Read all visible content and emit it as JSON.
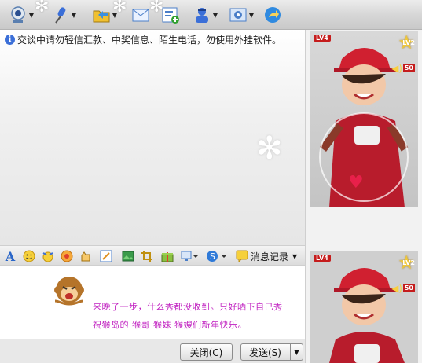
{
  "notice": {
    "text": "交谈中请勿轻信汇款、中奖信息、陌生电话，勿使用外挂软件。"
  },
  "format_bar": {
    "font_label": "A",
    "message_record_label": "消息记录"
  },
  "chat_input": {
    "line1": "来晚了一步，什么秀都没收到。只好晒下自己秀",
    "line2": "祝猴岛的 猴哥 猴妹 猴嫂们新年快乐。"
  },
  "buttons": {
    "close_label": "关闭(C)",
    "send_label": "发送(S)"
  },
  "avatars": [
    {
      "level": "LV4",
      "level2": "LV2",
      "count": "50"
    },
    {
      "level": "LV4",
      "level2": "LV2",
      "count": "50"
    }
  ],
  "colors": {
    "chat_text": "#c020c0",
    "accent_red": "#c51c1c"
  }
}
